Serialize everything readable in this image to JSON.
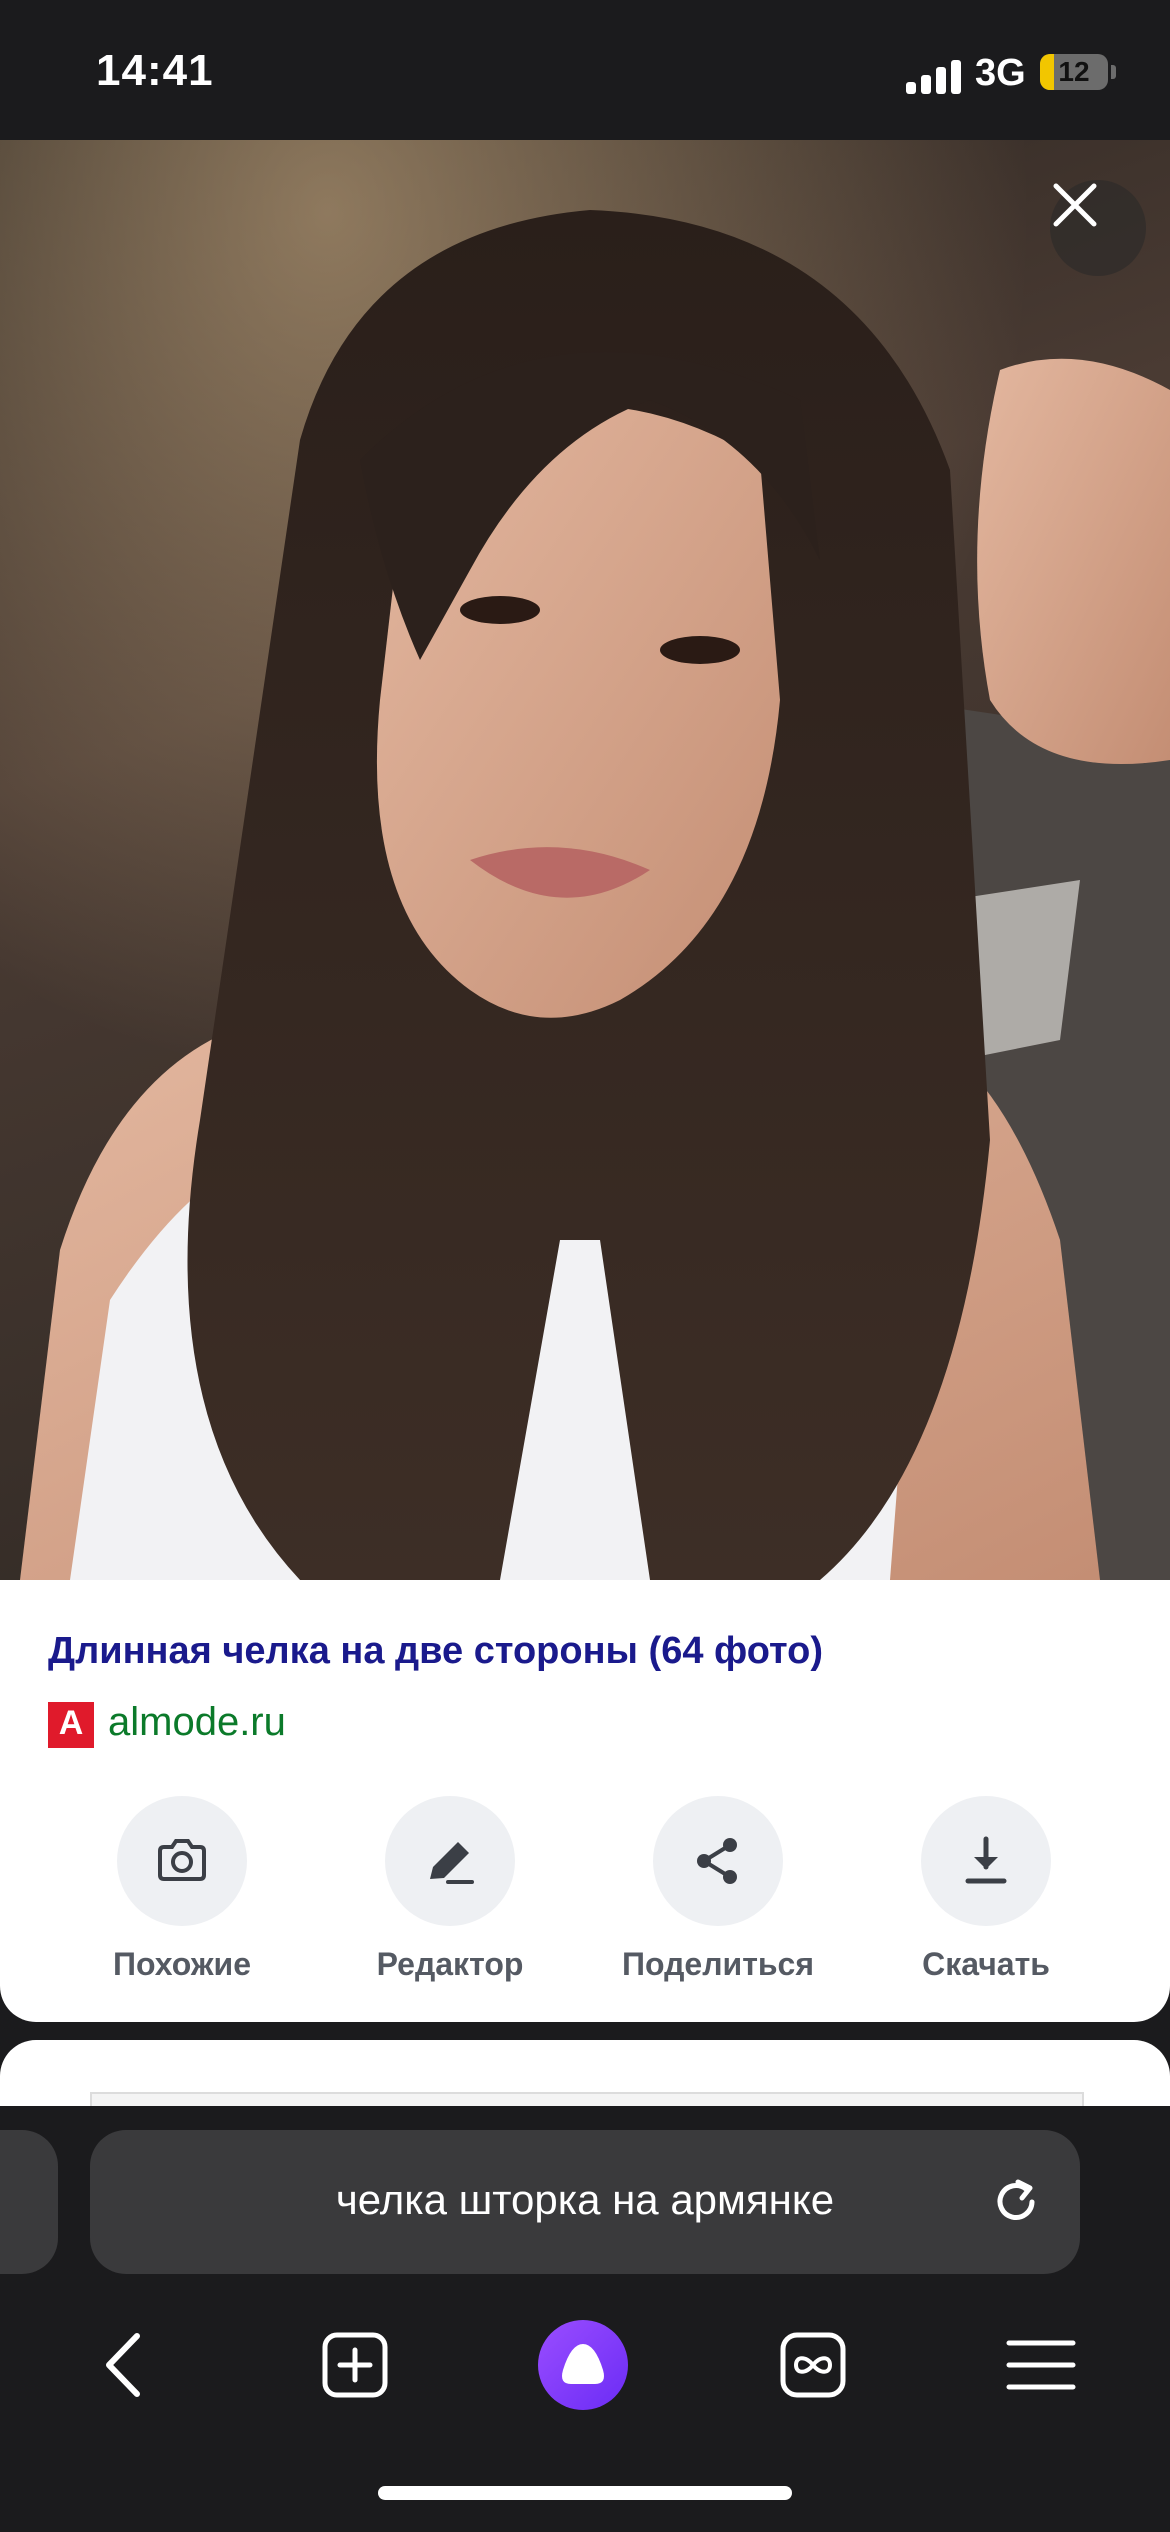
{
  "status_bar": {
    "time": "14:41",
    "network": "3G",
    "battery": "12"
  },
  "viewer": {
    "image_alt": "Portrait of a woman with long dark straight hair and curtain bangs"
  },
  "result": {
    "title": "Длинная челка на две стороны (64 фото)",
    "source_logo": "A",
    "source_domain": "almode.ru"
  },
  "actions": [
    {
      "label": "Похожие",
      "icon": "camera-icon"
    },
    {
      "label": "Редактор",
      "icon": "pencil-icon"
    },
    {
      "label": "Поделиться",
      "icon": "share-icon"
    },
    {
      "label": "Скачать",
      "icon": "download-icon"
    }
  ],
  "browser": {
    "search_query": "челка шторка на армянке"
  },
  "colors": {
    "title": "#1a1a8c",
    "domain": "#0b7a2a",
    "logo": "#e01a2b",
    "alice": "#7b35f7",
    "battery": "#f2c600"
  }
}
